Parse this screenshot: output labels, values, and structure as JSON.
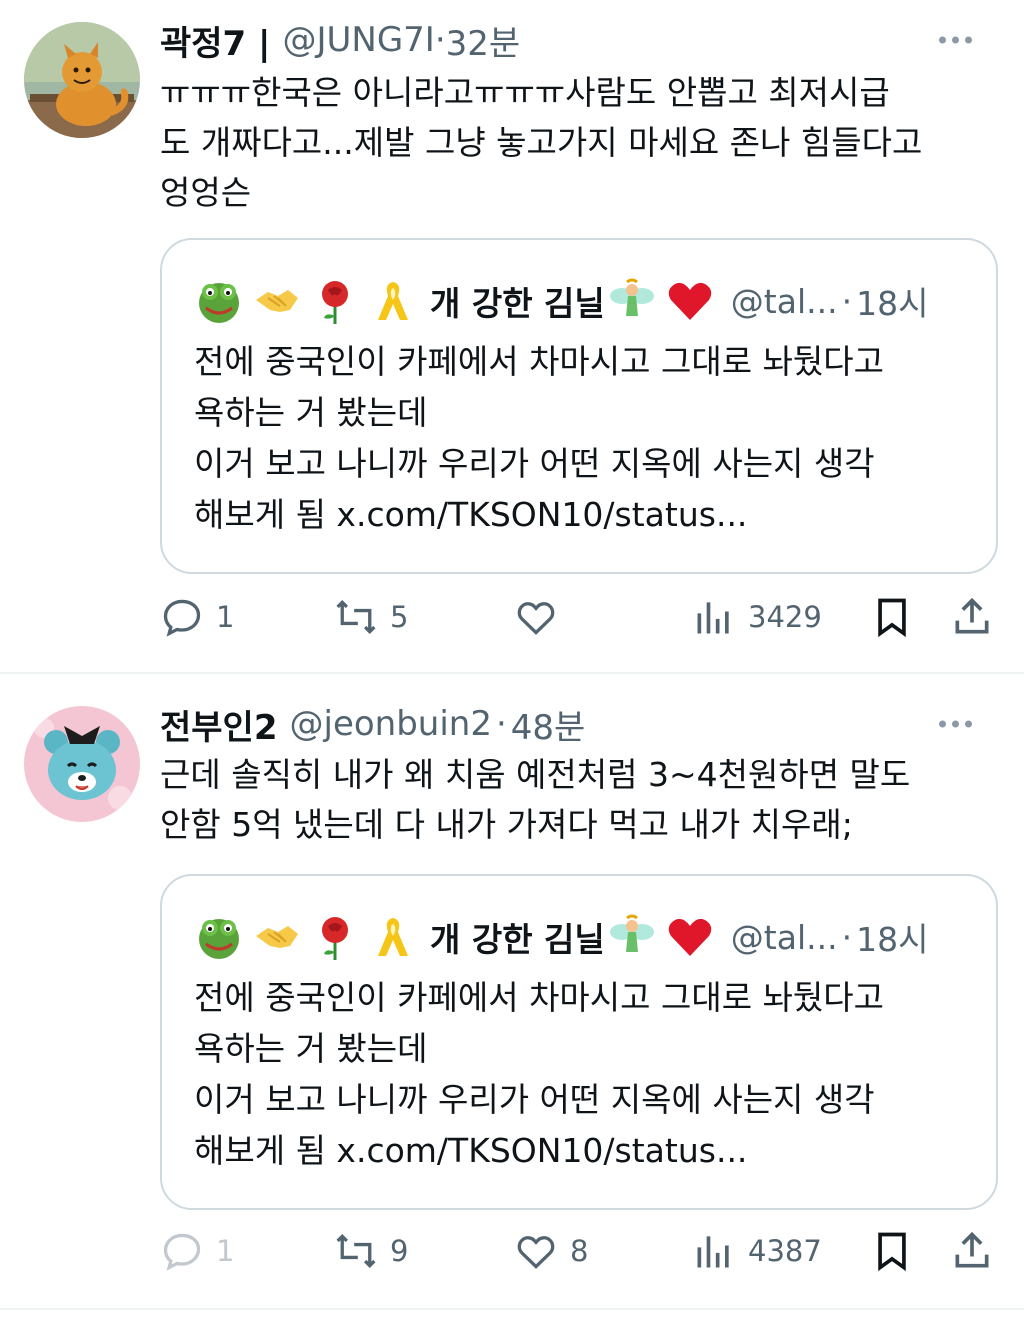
{
  "tweets": [
    {
      "name": "곽정7 |",
      "handle": "@JUNG7I",
      "dot": "·",
      "time": "32분",
      "text": "ㅠㅠㅠ한국은 아니라고ㅠㅠㅠ사람도 안뽑고 최저시급\n도 개짜다고...제발 그냥 놓고가지 마세요 존나 힘들다고\n엉엉슨",
      "quote": {
        "emoji_icons": [
          "frog-icon",
          "handshake-icon",
          "rose-icon",
          "yellow-ribbon-icon"
        ],
        "name": "개 강한 김닐",
        "name_emoji_icons": [
          "fairy-icon",
          "red-heart-icon"
        ],
        "handle": "@tal...",
        "dot": "·",
        "time": "18시",
        "text": "전에 중국인이 카페에서 차마시고 그대로 놔뒀다고\n욕하는 거 봤는데\n이거 보고 나니까 우리가 어떤 지옥에 사는지 생각\n해보게 됨 x.com/TKSON10/status..."
      },
      "actions": {
        "reply_count": "1",
        "retweet_count": "5",
        "like_count": "",
        "views_count": "3429"
      }
    },
    {
      "name": "전부인2",
      "handle": "@jeonbuin2",
      "dot": "·",
      "time": "48분",
      "text": "근데 솔직히 내가 왜 치움 예전처럼 3~4천원하면 말도\n안함 5억 냈는데 다 내가 가져다 먹고 내가 치우래;",
      "quote": {
        "emoji_icons": [
          "frog-icon",
          "handshake-icon",
          "rose-icon",
          "yellow-ribbon-icon"
        ],
        "name": "개 강한 김닐",
        "name_emoji_icons": [
          "fairy-icon",
          "red-heart-icon"
        ],
        "handle": "@tal...",
        "dot": "·",
        "time": "18시",
        "text": "전에 중국인이 카페에서 차마시고 그대로 놔뒀다고\n욕하는 거 봤는데\n이거 보고 나니까 우리가 어떤 지옥에 사는지 생각\n해보게 됨 x.com/TKSON10/status..."
      },
      "actions": {
        "reply_count": "1",
        "retweet_count": "9",
        "like_count": "8",
        "views_count": "4387"
      }
    }
  ],
  "colors": {
    "text_primary": "#0f1419",
    "text_secondary": "#536471",
    "border": "#cfd9de",
    "divider": "#eff3f4"
  }
}
